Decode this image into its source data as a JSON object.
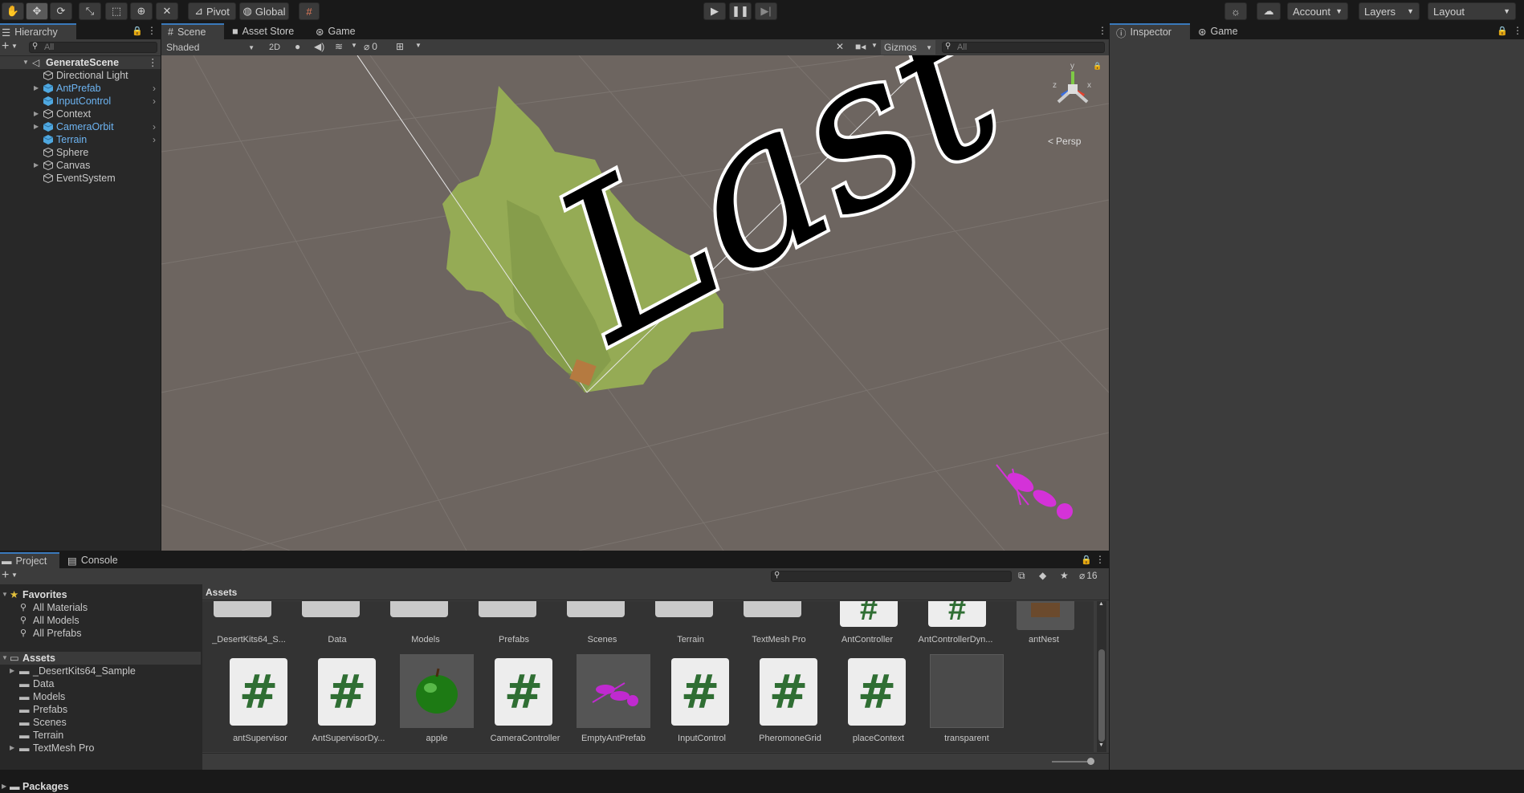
{
  "toolbar": {
    "pivot_label": "Pivot",
    "global_label": "Global",
    "account_label": "Account",
    "layers_label": "Layers",
    "layout_label": "Layout"
  },
  "hierarchy": {
    "tab_label": "Hierarchy",
    "search_placeholder": "All",
    "scene_name": "GenerateScene",
    "items": [
      {
        "label": "Directional Light",
        "prefab": false,
        "expandable": false
      },
      {
        "label": "AntPrefab",
        "prefab": true,
        "expandable": true
      },
      {
        "label": "InputControl",
        "prefab": true,
        "expandable": false
      },
      {
        "label": "Context",
        "prefab": false,
        "expandable": true
      },
      {
        "label": "CameraOrbit",
        "prefab": true,
        "expandable": true
      },
      {
        "label": "Terrain",
        "prefab": true,
        "expandable": false
      },
      {
        "label": "Sphere",
        "prefab": false,
        "expandable": false
      },
      {
        "label": "Canvas",
        "prefab": false,
        "expandable": true
      },
      {
        "label": "EventSystem",
        "prefab": false,
        "expandable": false
      }
    ]
  },
  "scene_tabs": {
    "scene": "Scene",
    "asset_store": "Asset Store",
    "game": "Game"
  },
  "scene_toolbar": {
    "shading_mode": "Shaded",
    "mode_2d": "2D",
    "hidden_count": "0",
    "gizmos_label": "Gizmos",
    "search_placeholder": "All"
  },
  "scene_view": {
    "persp_label": "Persp",
    "gizmo_y": "y",
    "gizmo_x": "x",
    "gizmo_z": "z",
    "overlay_text": "Last"
  },
  "right_tabs": {
    "inspector": "Inspector",
    "game": "Game"
  },
  "bottom_tabs": {
    "project": "Project",
    "console": "Console"
  },
  "project": {
    "hidden_count": "16",
    "breadcrumb": "Assets",
    "favorites_label": "Favorites",
    "favorites": [
      "All Materials",
      "All Models",
      "All Prefabs"
    ],
    "assets_label": "Assets",
    "asset_folders": [
      "_DesertKits64_Sample",
      "Data",
      "Models",
      "Prefabs",
      "Scenes",
      "Terrain",
      "TextMesh Pro"
    ],
    "packages_label": "Packages",
    "grid_row1": [
      "_DesertKits64_S...",
      "Data",
      "Models",
      "Prefabs",
      "Scenes",
      "Terrain",
      "TextMesh Pro",
      "AntController",
      "AntControllerDyn...",
      "antNest"
    ],
    "grid_row2": [
      "antSupervisor",
      "AntSupervisorDy...",
      "apple",
      "CameraController",
      "EmptyAntPrefab",
      "InputControl",
      "PheromoneGrid",
      "placeContext",
      "transparent"
    ]
  },
  "colors": {
    "accent": "#3a79bb",
    "prefab_blue": "#6db4f2",
    "scene_bg": "#6d6560",
    "panel_bg": "#282828"
  }
}
